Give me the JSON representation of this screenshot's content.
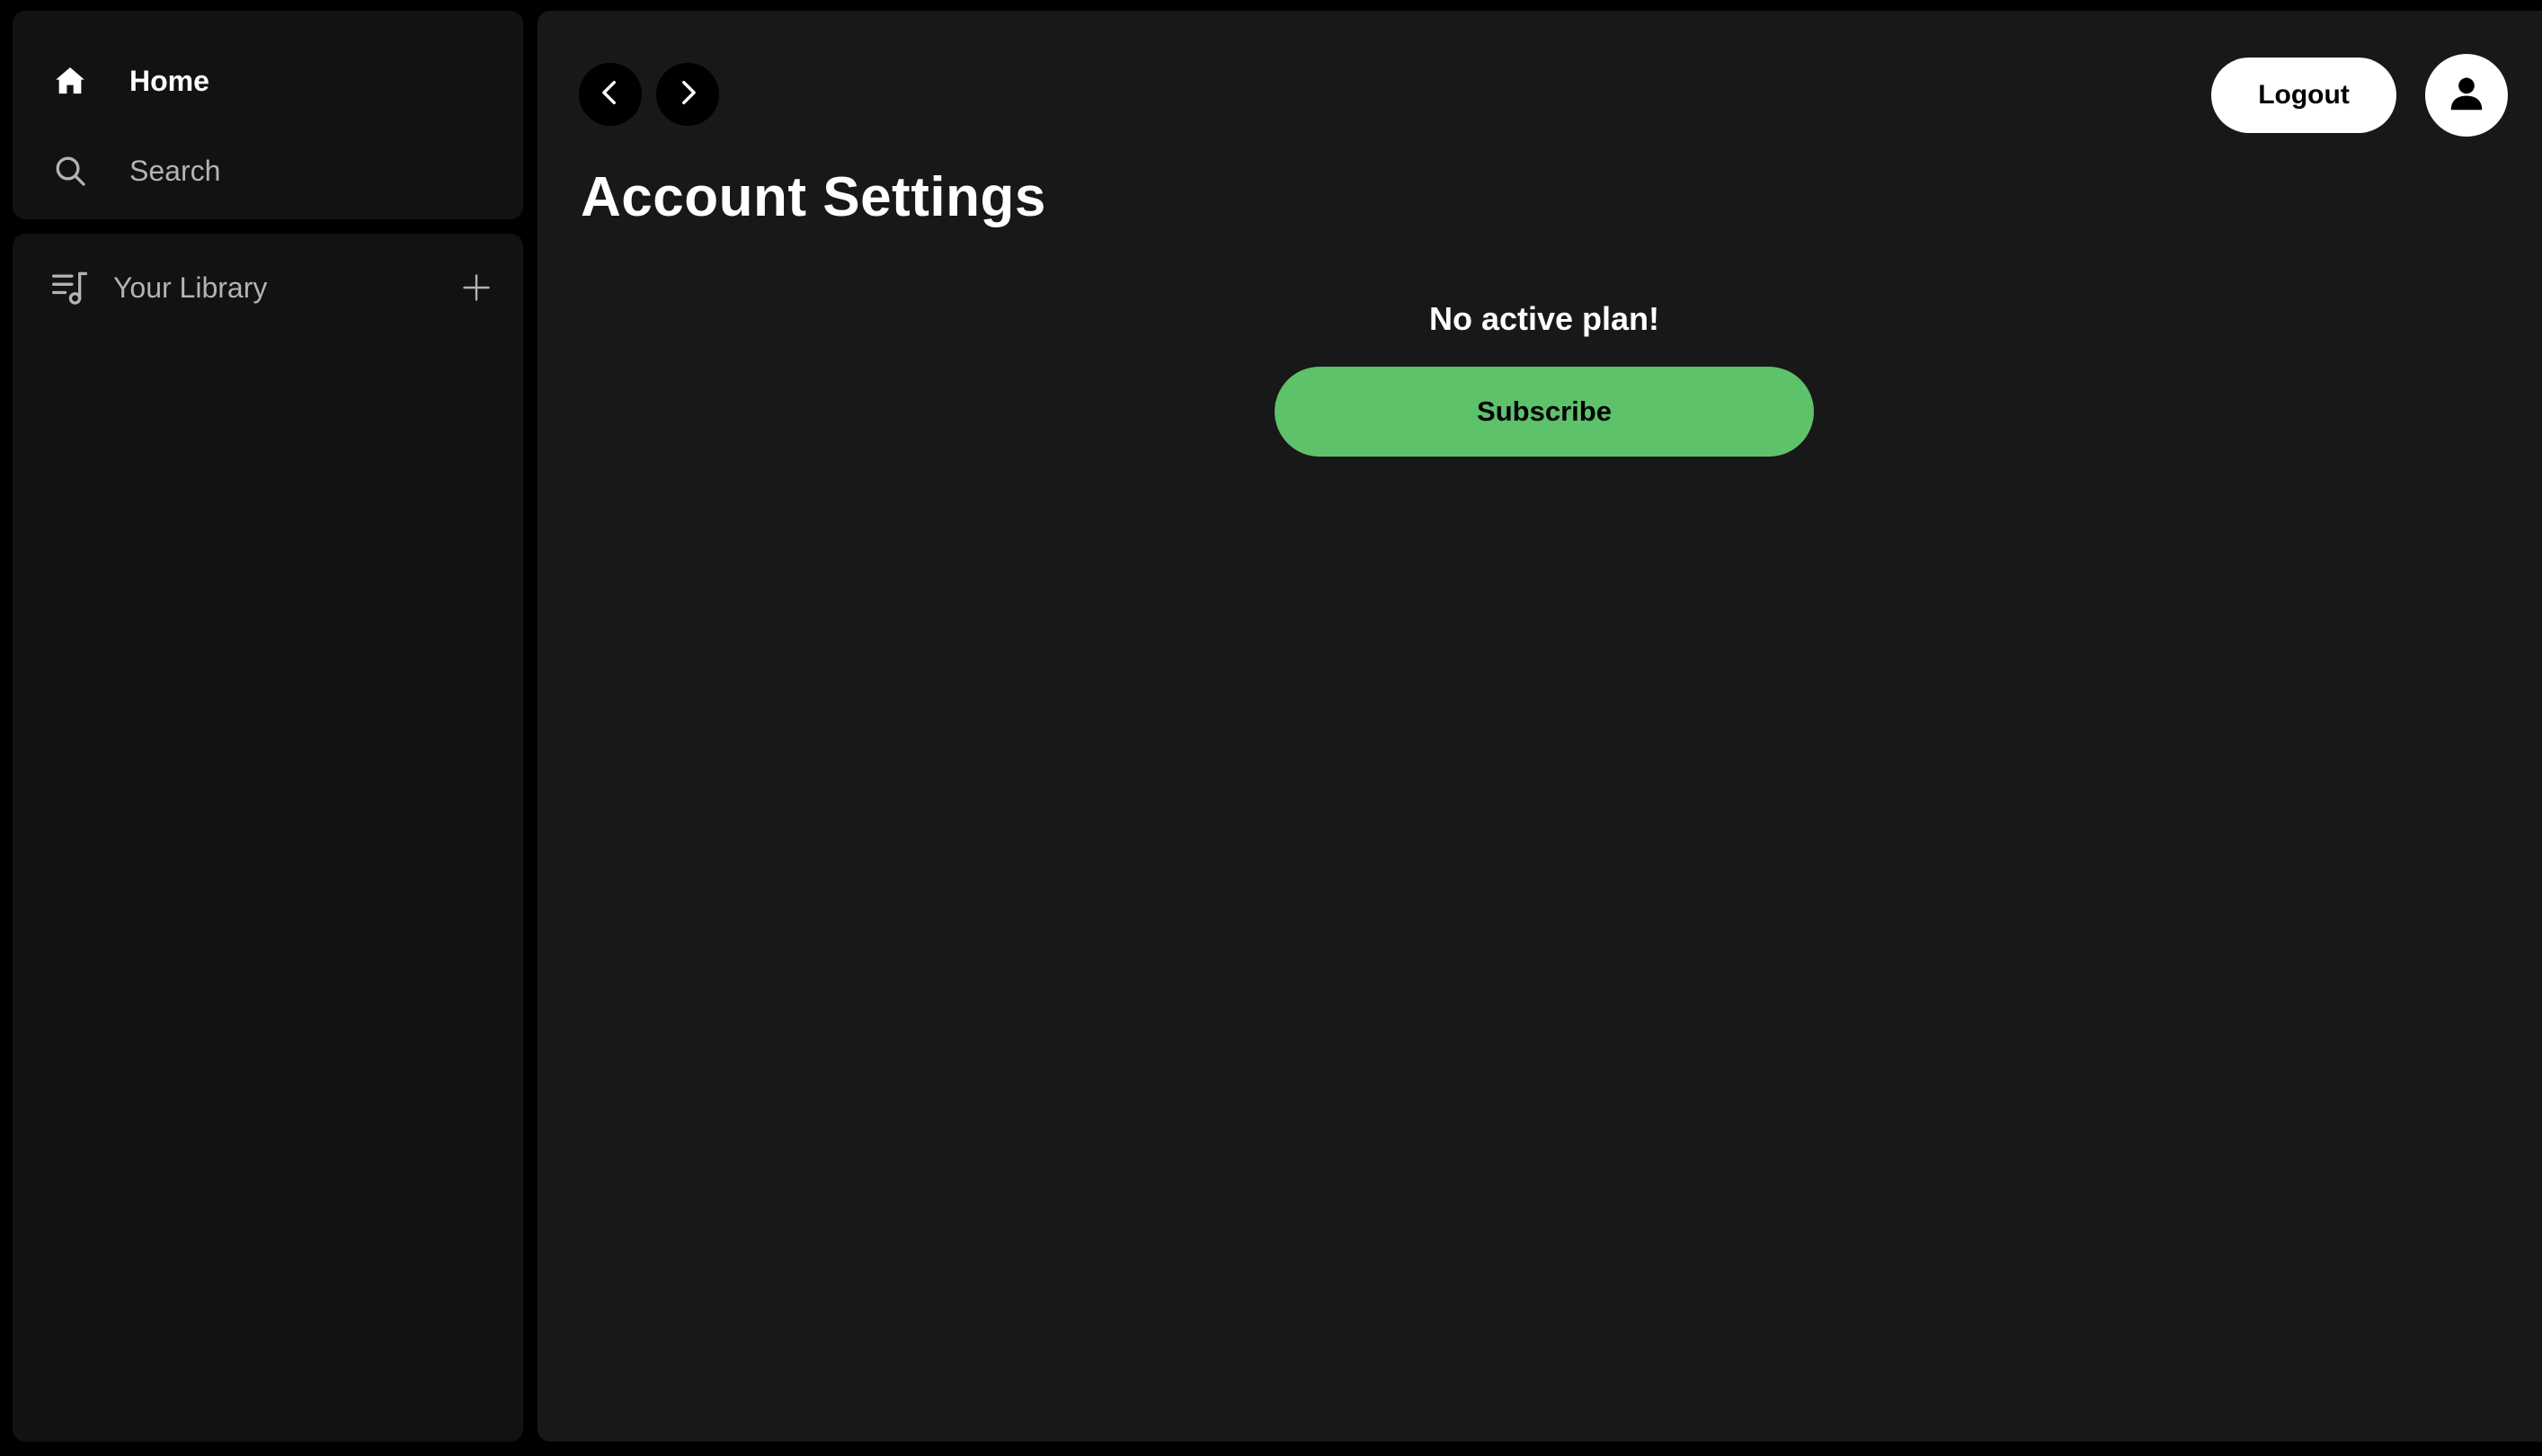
{
  "colors": {
    "background": "#000000",
    "panel": "#121212",
    "main_panel": "#181818",
    "accent": "#5ec26a",
    "primary_text": "#ffffff",
    "secondary_text": "#b3b3b3"
  },
  "sidebar": {
    "nav": [
      {
        "label": "Home",
        "icon": "home-icon"
      },
      {
        "label": "Search",
        "icon": "search-icon"
      }
    ],
    "library": {
      "label": "Your Library",
      "icon": "library-icon",
      "add_icon": "plus-icon"
    }
  },
  "header": {
    "back_icon": "chevron-left-icon",
    "forward_icon": "chevron-right-icon",
    "logout_label": "Logout",
    "avatar_icon": "user-icon"
  },
  "main": {
    "title": "Account Settings",
    "plan_status": "No active plan!",
    "subscribe_label": "Subscribe"
  }
}
